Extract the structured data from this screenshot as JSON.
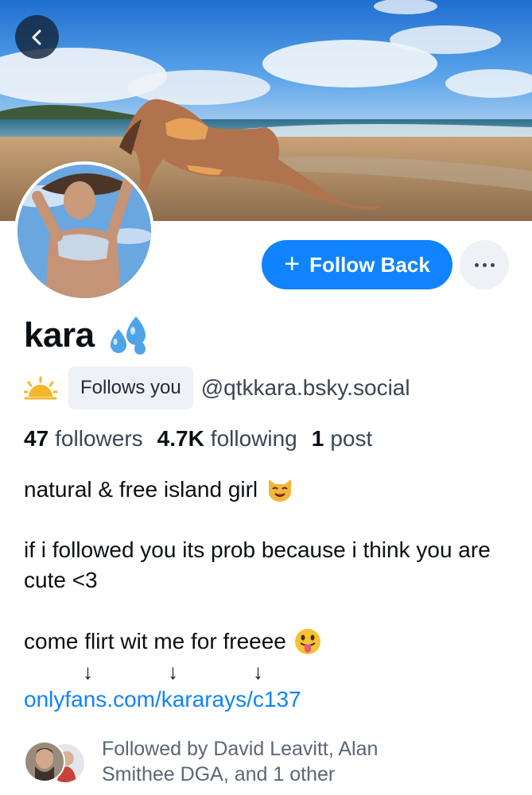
{
  "header": {
    "back_icon": "chevron-left-icon"
  },
  "actions": {
    "follow_back_label": "Follow Back",
    "follow_icon": "plus-icon",
    "more_icon": "ellipsis-icon"
  },
  "profile": {
    "display_name": "kara",
    "name_emoji": "sweat-droplets-icon",
    "status_icon": "sun-icon",
    "follows_you_label": "Follows you",
    "handle": "@qtkkara.bsky.social"
  },
  "stats": {
    "followers_count": "47",
    "followers_label": "followers",
    "following_count": "4.7K",
    "following_label": "following",
    "posts_count": "1",
    "posts_label": "post"
  },
  "bio": {
    "line1": "natural & free island girl",
    "line1_emoji": "smiling-cat-icon",
    "line2": "if i followed you its prob because i think you are cute <3",
    "line3": "come flirt wit me for freeee",
    "line3_emoji": "tongue-out-face-icon",
    "arrow": "↓",
    "link": "onlyfans.com/kararays/c137"
  },
  "followed_by": {
    "text": "Followed by David Leavitt, Alan Smithee DGA, and 1 other"
  },
  "colors": {
    "accent": "#1083fe",
    "muted_text": "#5b6776",
    "badge_bg": "#eef1f5"
  }
}
